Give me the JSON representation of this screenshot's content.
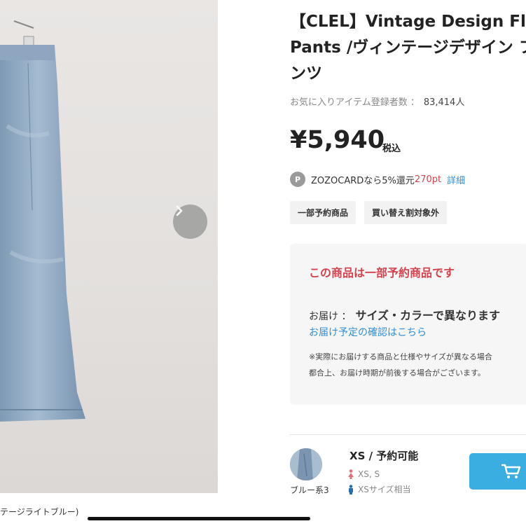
{
  "product": {
    "title": "【CLEL】Vintage Design Flare Pants /ヴィンテージデザイン フレアパンツ",
    "title_display": "【CLEL】Vintage Design Fla\nPants /ヴィンテージデザイン フ\nンツ",
    "favorites_label": "お気に入りアイテム登録者数 ：",
    "favorites_count": "83,414人",
    "price": "¥5,940",
    "tax_label": "税込",
    "photo_caption": "テージライトブルー)"
  },
  "zozocard": {
    "badge": "P",
    "text": "ZOZOCARDなら5%還元",
    "points": "270pt",
    "detail_link": "詳細"
  },
  "tags": [
    "一部予約商品",
    "買い替え割対象外"
  ],
  "notice": {
    "title": "この商品は一部予約商品です",
    "delivery_label": "お届け ：",
    "delivery_value": "サイズ・カラーで異なります",
    "delivery_link": "お届け予定の確認はこちら",
    "note_line1": "※実際にお届けする商品と仕様やサイズが異なる場合",
    "note_line2": "都合上、お届け時期が前後する場合がございます。"
  },
  "variant": {
    "color_label": "ブルー系3",
    "size_status": "XS / 予約可能",
    "female_size": "XS, S",
    "male_size": "XSサイズ相当"
  },
  "colors": {
    "accent_red": "#d4434d",
    "link_blue": "#2f8fd6",
    "cart_blue": "#3aaee0",
    "female_icon": "#e26f7b",
    "male_icon": "#2b6cb0"
  },
  "icons": [
    "chevron-right-icon",
    "points-icon",
    "female-icon",
    "male-icon",
    "cart-icon"
  ]
}
